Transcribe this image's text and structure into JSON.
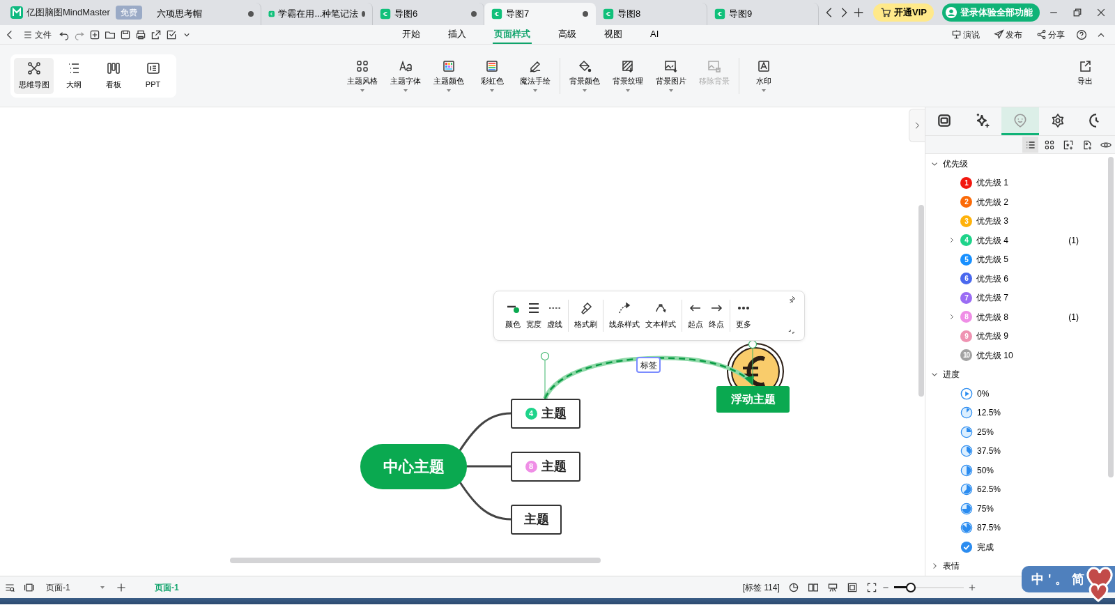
{
  "app_tab": {
    "title": "亿图脑图MindMaster",
    "badge": "免费"
  },
  "tabs": [
    {
      "label": "六项思考帽",
      "kind": "plain",
      "modified": true,
      "selected": false
    },
    {
      "label": "学霸在用...种笔记法",
      "kind": "map",
      "modified": true,
      "selected": false
    },
    {
      "label": "导图6",
      "kind": "map",
      "modified": true,
      "selected": false
    },
    {
      "label": "导图7",
      "kind": "map",
      "modified": true,
      "selected": true
    },
    {
      "label": "导图8",
      "kind": "map",
      "modified": false,
      "selected": false
    },
    {
      "label": "导图9",
      "kind": "map",
      "modified": false,
      "selected": false
    }
  ],
  "vip_button": "开通VIP",
  "login_button": "登录体验全部功能",
  "menu": {
    "file": "文件",
    "tabs": [
      {
        "label": "开始",
        "selected": false
      },
      {
        "label": "插入",
        "selected": false
      },
      {
        "label": "页面样式",
        "selected": true
      },
      {
        "label": "高级",
        "selected": false
      },
      {
        "label": "视图",
        "selected": false
      },
      {
        "label": "AI",
        "selected": false
      }
    ],
    "actions": [
      "演说",
      "发布",
      "分享"
    ]
  },
  "views": [
    {
      "label": "思维导图",
      "selected": true
    },
    {
      "label": "大纲",
      "selected": false
    },
    {
      "label": "看板",
      "selected": false
    },
    {
      "label": "PPT",
      "selected": false
    }
  ],
  "ribbon": {
    "groups": [
      [
        {
          "label": "主题风格",
          "dropdown": true,
          "disabled": false
        },
        {
          "label": "主题字体",
          "dropdown": true,
          "disabled": false
        },
        {
          "label": "主题颜色",
          "dropdown": true,
          "disabled": false
        },
        {
          "label": "彩虹色",
          "dropdown": true,
          "disabled": false
        },
        {
          "label": "魔法手绘",
          "dropdown": true,
          "disabled": false
        }
      ],
      [
        {
          "label": "背景颜色",
          "dropdown": true,
          "disabled": false
        },
        {
          "label": "背景纹理",
          "dropdown": true,
          "disabled": false
        },
        {
          "label": "背景图片",
          "dropdown": true,
          "disabled": false
        },
        {
          "label": "移除背景",
          "dropdown": false,
          "disabled": true
        }
      ],
      [
        {
          "label": "水印",
          "dropdown": true,
          "disabled": false
        }
      ]
    ],
    "export": "导出"
  },
  "mindmap": {
    "central": "中心主题",
    "topics": [
      {
        "label": "主题",
        "marker": {
          "text": "4",
          "color": "#1ed38a"
        }
      },
      {
        "label": "主题",
        "marker": {
          "text": "8",
          "color": "#ef8ee6"
        }
      },
      {
        "label": "主题"
      }
    ],
    "floating": "浮动主题",
    "relationship_label": "标签"
  },
  "float_toolbar": {
    "groups": [
      [
        "颜色",
        "宽度",
        "虚线"
      ],
      [
        "格式刷"
      ],
      [
        "线条样式",
        "文本样式"
      ],
      [
        "起点",
        "终点"
      ],
      [
        "更多"
      ]
    ]
  },
  "panel": {
    "tabs": [
      {
        "selected": false
      },
      {
        "selected": false
      },
      {
        "selected": true
      },
      {
        "selected": false
      },
      {
        "selected": false
      }
    ],
    "view_modes": [
      {
        "selected": true
      },
      {
        "selected": false
      },
      {
        "selected": false
      },
      {
        "selected": false
      },
      {
        "selected": false
      }
    ],
    "groups": [
      {
        "label": "优先级",
        "expanded": true,
        "items": [
          {
            "kind": "priority",
            "number": "1",
            "label": "优先级 1",
            "color": "#f2170f",
            "expandable": false
          },
          {
            "kind": "priority",
            "number": "2",
            "label": "优先级 2",
            "color": "#fb6a07",
            "expandable": false
          },
          {
            "kind": "priority",
            "number": "3",
            "label": "优先级 3",
            "color": "#ffb20a",
            "expandable": false
          },
          {
            "kind": "priority",
            "number": "4",
            "label": "优先级 4",
            "color": "#1ed38a",
            "expandable": true,
            "count": "(1)"
          },
          {
            "kind": "priority",
            "number": "5",
            "label": "优先级 5",
            "color": "#1890ff",
            "expandable": false
          },
          {
            "kind": "priority",
            "number": "6",
            "label": "优先级 6",
            "color": "#4a68ee",
            "expandable": false
          },
          {
            "kind": "priority",
            "number": "7",
            "label": "优先级 7",
            "color": "#9a6cf4",
            "expandable": false
          },
          {
            "kind": "priority",
            "number": "8",
            "label": "优先级 8",
            "color": "#ef8ee6",
            "expandable": true,
            "count": "(1)"
          },
          {
            "kind": "priority",
            "number": "9",
            "label": "优先级 9",
            "color": "#ef93b2",
            "expandable": false
          },
          {
            "kind": "priority",
            "number": "10",
            "label": "优先级 10",
            "color": "#a2a2a2",
            "expandable": false
          }
        ]
      },
      {
        "label": "进度",
        "expanded": true,
        "items": [
          {
            "kind": "start",
            "label": "0%"
          },
          {
            "kind": "eighth",
            "label": "12.5%"
          },
          {
            "kind": "quarter",
            "label": "25%"
          },
          {
            "kind": "threeeighths",
            "label": "37.5%"
          },
          {
            "kind": "half",
            "label": "50%"
          },
          {
            "kind": "fiveeighths",
            "label": "62.5%"
          },
          {
            "kind": "threequarters",
            "label": "75%"
          },
          {
            "kind": "seveneighths",
            "label": "87.5%"
          },
          {
            "kind": "done",
            "label": "完成"
          }
        ]
      },
      {
        "label": "表情",
        "expanded": false
      }
    ]
  },
  "status_bar": {
    "page_select": "页面-1",
    "pages": [
      {
        "label": "页面-1",
        "selected": true
      }
    ],
    "tag_count": "[标签 114]",
    "zoom": {
      "level": 0.24
    }
  },
  "ime_bar": {
    "items": [
      "中",
      "'",
      "。",
      "简"
    ]
  }
}
